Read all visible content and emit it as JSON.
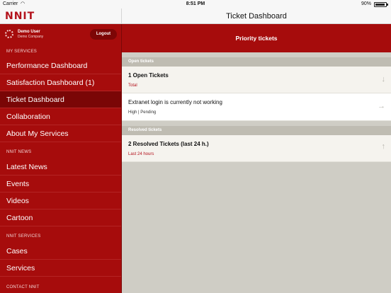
{
  "status_bar": {
    "carrier": "Carrier",
    "wifi_icon": "wifi-icon",
    "time": "8:51 PM",
    "battery_percent": "90%",
    "battery_level": 0.9
  },
  "header": {
    "logo_text": "NNIT",
    "title": "Ticket Dashboard"
  },
  "sidebar": {
    "user": {
      "name": "Demo User",
      "company": "Demo Company",
      "icon": "user-spinner-icon",
      "logout_label": "Logout"
    },
    "sections": [
      {
        "label": "MY SERVICES",
        "items": [
          {
            "label": "Performance Dashboard"
          },
          {
            "label": "Satisfaction Dashboard (1)"
          },
          {
            "label": "Ticket Dashboard",
            "active": true
          },
          {
            "label": "Collaboration"
          },
          {
            "label": "About My Services"
          }
        ]
      },
      {
        "label": "NNIT NEWS",
        "items": [
          {
            "label": "Latest News"
          },
          {
            "label": "Events"
          },
          {
            "label": "Videos"
          },
          {
            "label": "Cartoon"
          }
        ]
      },
      {
        "label": "NNIT SERVICES",
        "items": [
          {
            "label": "Cases"
          },
          {
            "label": "Services"
          }
        ]
      },
      {
        "label": "CONTACT NNIT",
        "items": []
      }
    ]
  },
  "main": {
    "header": "Priority tickets",
    "groups": [
      {
        "label": "Open tickets",
        "rows": [
          {
            "title": "1 Open Tickets",
            "subtitle": "Total",
            "arrow_icon": "arrow-down-icon"
          },
          {
            "title": "Extranet login is currently not working",
            "subtitle": "High | Pending",
            "arrow_icon": "arrow-right-icon"
          }
        ]
      },
      {
        "label": "Resolved tickets",
        "rows": [
          {
            "title": "2 Resolved Tickets (last 24 h.)",
            "subtitle": "Last 24 hours",
            "arrow_icon": "arrow-up-icon"
          }
        ]
      }
    ]
  },
  "colors": {
    "brand_red": "#a60c0c",
    "active_item": "#7a0606",
    "logo_red": "#b3121c",
    "content_bg": "#cfcdc5"
  }
}
